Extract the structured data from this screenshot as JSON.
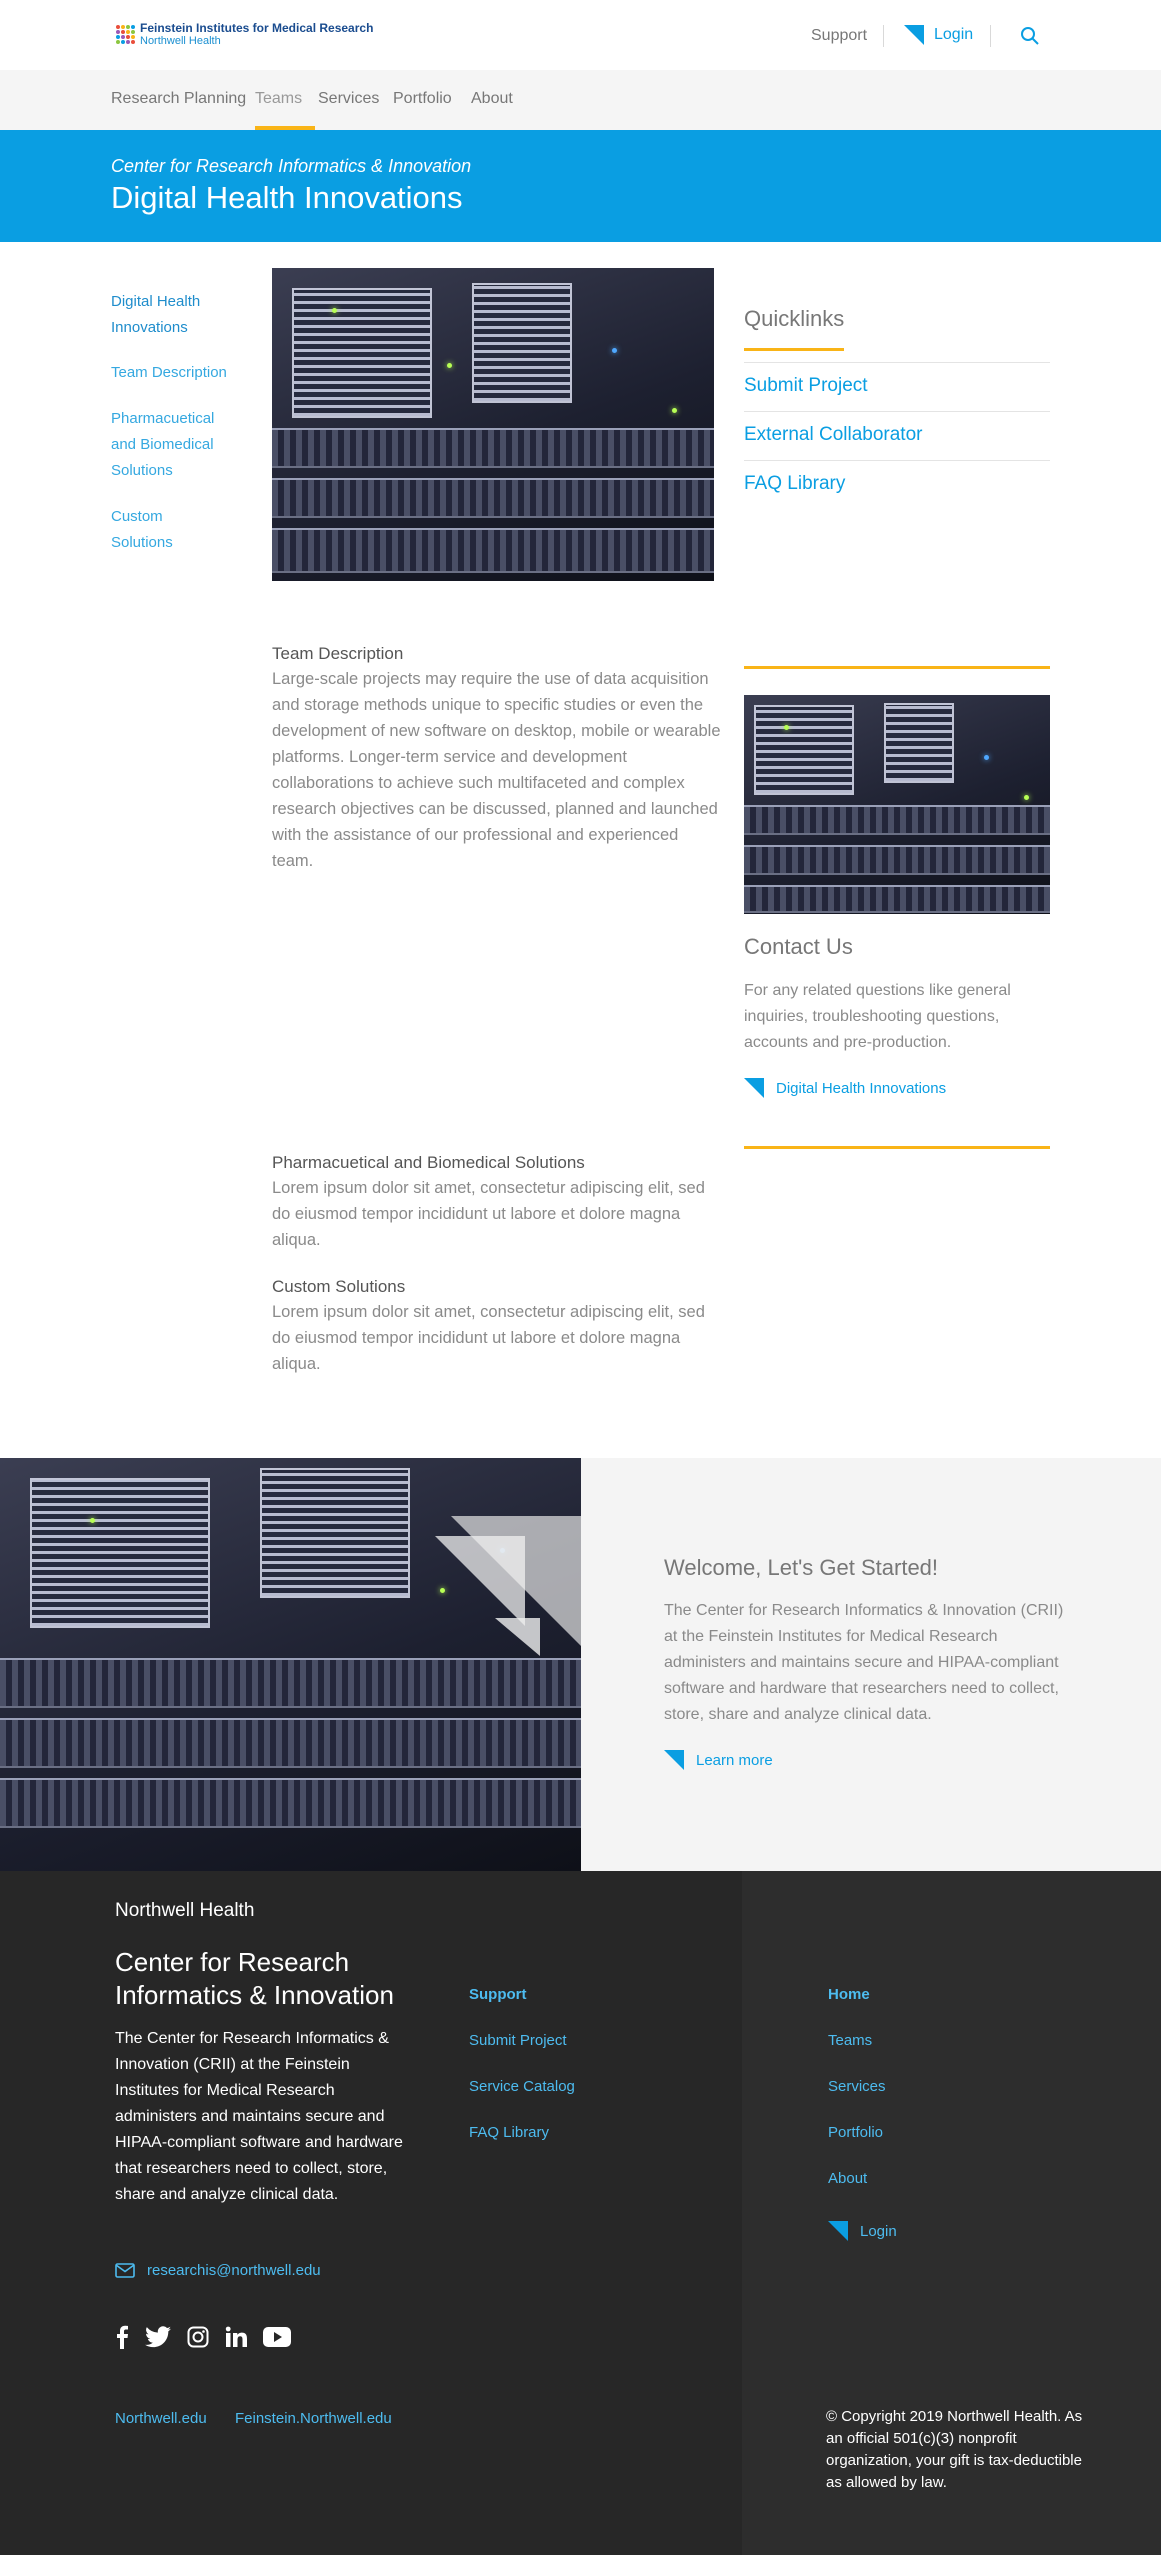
{
  "header": {
    "logo_line1": "Feinstein Institutes for Medical Research",
    "logo_line2": "Northwell Health",
    "support_label": "Support",
    "login_label": "Login"
  },
  "nav": {
    "items": [
      {
        "label": "Research Planning",
        "active": false
      },
      {
        "label": "Teams",
        "active": true
      },
      {
        "label": "Services",
        "active": false
      },
      {
        "label": "Portfolio",
        "active": false
      },
      {
        "label": "About",
        "active": false
      }
    ]
  },
  "banner": {
    "subtitle": "Center for Research Informatics & Innovation",
    "title": "Digital Health Innovations"
  },
  "sidebar": {
    "items": [
      {
        "label": "Digital Health Innovations",
        "active": true
      },
      {
        "label": "Team Description",
        "active": false
      },
      {
        "label": "Pharmacuetical and Biomedical Solutions",
        "active": false
      },
      {
        "label": "Custom Solutions",
        "active": false
      }
    ]
  },
  "quicklinks": {
    "title": "Quicklinks",
    "links": [
      "Submit Project",
      "External Collaborator",
      "FAQ Library"
    ]
  },
  "sections": [
    {
      "heading": "Team Description",
      "body": "Large-scale projects may require the use of data acquisition and storage methods unique to specific studies or even the development of new software on desktop, mobile or wearable platforms. Longer-term service and development collaborations to achieve such multifaceted and complex research objectives can be discussed, planned and launched with the assistance of our professional and experienced team."
    },
    {
      "heading": "Pharmacuetical and Biomedical Solutions",
      "body": "Lorem ipsum dolor sit amet, consectetur adipiscing elit, sed do eiusmod tempor incididunt ut labore et dolore magna aliqua."
    },
    {
      "heading": "Custom Solutions",
      "body": "Lorem ipsum dolor sit amet, consectetur adipiscing elit, sed do eiusmod tempor incididunt ut labore et dolore magna aliqua."
    }
  ],
  "contact": {
    "title": "Contact Us",
    "text": "For any related questions like general inquiries, troubleshooting questions, accounts and pre-production.",
    "link": "Digital Health Innovations"
  },
  "welcome": {
    "title": "Welcome, Let's Get Started!",
    "text": "The Center for Research Informatics & Innovation (CRII) at the Feinstein Institutes for Medical Research administers and maintains secure and HIPAA-compliant software and hardware that researchers need to collect, store, share and analyze clinical data.",
    "link": "Learn more"
  },
  "footer": {
    "brand": "Northwell Health",
    "title": "Center for Research Informatics & Innovation",
    "text": "The Center for Research Informatics & Innovation (CRII) at the Feinstein Institutes for Medical Research administers and maintains secure and HIPAA-compliant software and hardware that researchers need to collect, store, share and analyze clinical data.",
    "email": "researchis@northwell.edu",
    "support_heading": "Support",
    "support_links": [
      "Submit Project",
      "Service Catalog",
      "FAQ Library"
    ],
    "home_heading": "Home",
    "home_links": [
      "Teams",
      "Services",
      "Portfolio",
      "About"
    ],
    "login_label": "Login",
    "bottom_links": [
      "Northwell.edu",
      "Feinstein.Northwell.edu"
    ],
    "copyright": "© Copyright 2019 Northwell Health. As an official 501(c)(3) nonprofit organization, your gift is tax-deductible as allowed by law."
  },
  "colors": {
    "accent_blue": "#0a9ee2",
    "accent_yellow": "#f9b417",
    "footer_bg": "#272727",
    "footer_link": "#4dbcf0"
  }
}
